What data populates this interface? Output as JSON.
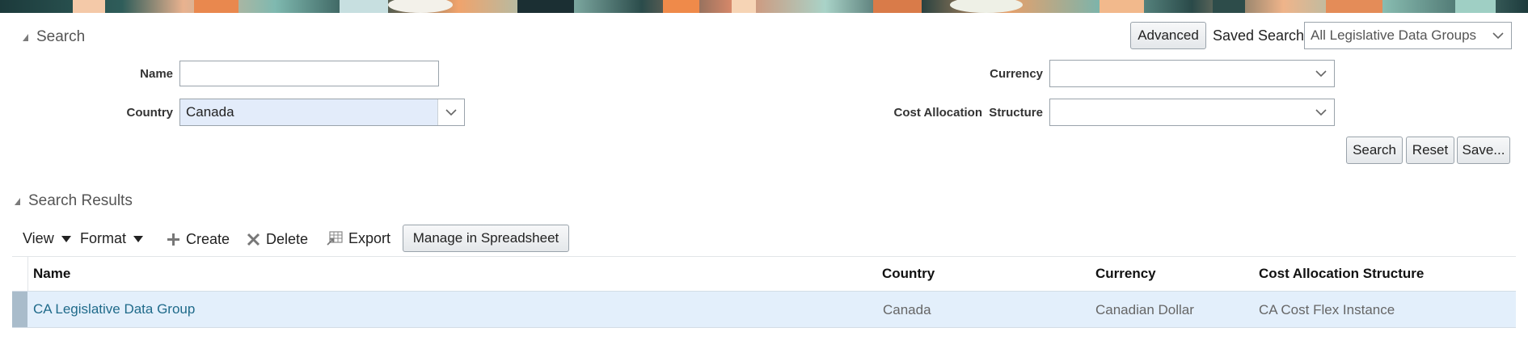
{
  "search": {
    "section_title": "Search",
    "advanced_label": "Advanced",
    "saved_search_label": "Saved Search",
    "saved_search_value": "All Legislative Data Groups",
    "fields": {
      "name_label": "Name",
      "name_value": "",
      "country_label": "Country",
      "country_value": "Canada",
      "currency_label": "Currency",
      "currency_value": "",
      "cost_allocation_label": "Cost Allocation  Structure",
      "cost_allocation_value": ""
    },
    "buttons": {
      "search": "Search",
      "reset": "Reset",
      "save": "Save..."
    }
  },
  "results": {
    "section_title": "Search Results",
    "toolbar": {
      "view": "View",
      "format": "Format",
      "create": "Create",
      "delete": "Delete",
      "export": "Export",
      "manage": "Manage in Spreadsheet"
    },
    "columns": [
      "Name",
      "Country",
      "Currency",
      "Cost Allocation Structure"
    ],
    "rows": [
      {
        "name": "CA Legislative Data Group",
        "country": "Canada",
        "currency": "Canadian Dollar",
        "cost_allocation": "CA Cost Flex Instance"
      }
    ]
  },
  "colors": {
    "link": "#1f6a8a",
    "selected_row": "#e3effb",
    "selected_marker": "#a9bccb"
  }
}
